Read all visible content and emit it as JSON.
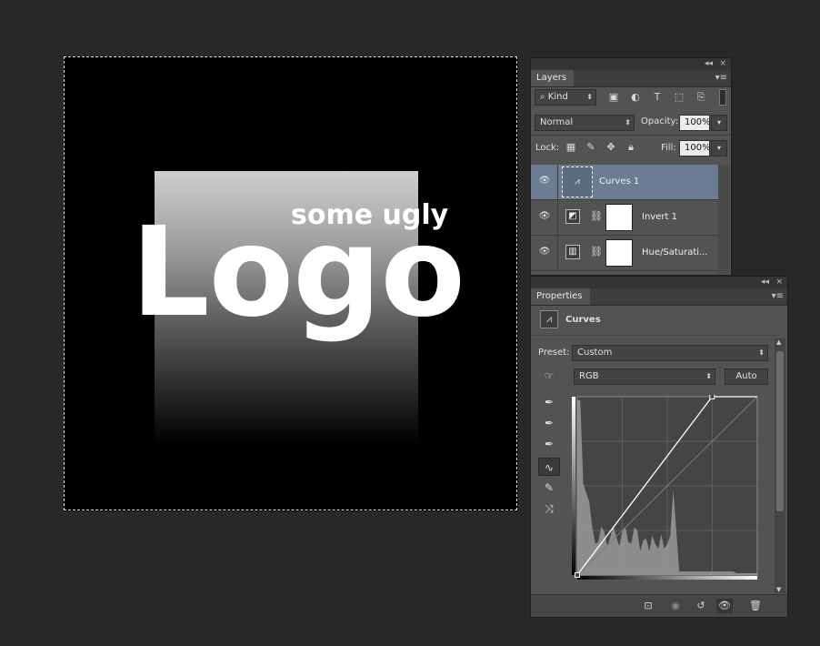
{
  "canvas": {
    "tagline": "some ugly",
    "logo": "Logo"
  },
  "layers_panel": {
    "collapse_icon": "double-chevron-left-icon",
    "close_glyph": "×",
    "tab_label": "Layers",
    "filter_kind": "Kind",
    "blend_mode": "Normal",
    "opacity_label": "Opacity:",
    "opacity_value": "100%",
    "lock_label": "Lock:",
    "fill_label": "Fill:",
    "fill_value": "100%",
    "layers": [
      {
        "name": "Curves 1",
        "selected": true,
        "type": "curves"
      },
      {
        "name": "Invert 1",
        "selected": false,
        "type": "invert"
      },
      {
        "name": "Hue/Saturati...",
        "selected": false,
        "type": "hue-saturation"
      }
    ]
  },
  "properties_panel": {
    "close_glyph": "×",
    "tab_label": "Properties",
    "adjustment_title": "Curves",
    "preset_label": "Preset:",
    "preset_value": "Custom",
    "channel_value": "RGB",
    "auto_label": "Auto",
    "curve": {
      "points": [
        [
          0,
          0
        ],
        [
          191,
          255
        ]
      ],
      "histogram_color": "#9a9a9a"
    }
  },
  "colors": {
    "app_bg": "#282828",
    "panel_bg": "#535353",
    "selected_layer": "#6b7c93"
  }
}
